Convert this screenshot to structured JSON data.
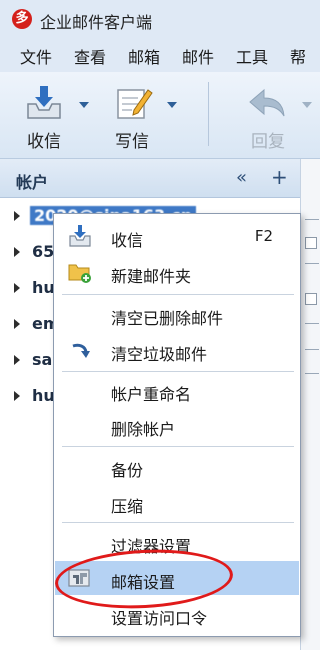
{
  "app": {
    "title": "企业邮件客户端",
    "logo_glyph": "多"
  },
  "menu": [
    "文件",
    "查看",
    "邮箱",
    "邮件",
    "工具",
    "帮助"
  ],
  "toolbar": {
    "receive_label": "收信",
    "compose_label": "写信",
    "reply_label": "回复"
  },
  "panel": {
    "title": "帐户",
    "collapse_glyph": "«",
    "add_glyph": "+"
  },
  "accounts": [
    {
      "name": "2020@sina163.cn"
    },
    {
      "name": "65"
    },
    {
      "name": "hu"
    },
    {
      "name": "em"
    },
    {
      "name": "sa"
    },
    {
      "name": "hu"
    }
  ],
  "context_menu": {
    "receive": {
      "label": "收信",
      "shortcut": "F2"
    },
    "new_folder": {
      "label": "新建邮件夹"
    },
    "empty_deleted": {
      "label": "清空已删除邮件"
    },
    "empty_junk": {
      "label": "清空垃圾邮件"
    },
    "rename_account": {
      "label": "帐户重命名"
    },
    "delete_account": {
      "label": "删除帐户"
    },
    "backup": {
      "label": "备份"
    },
    "compress": {
      "label": "压缩"
    },
    "filter_settings": {
      "label": "过滤器设置"
    },
    "mailbox_settings": {
      "label": "邮箱设置"
    },
    "access_password": {
      "label": "设置访问口令"
    }
  },
  "colors": {
    "highlight": "#b5d2f3",
    "annotation": "#e01a1a",
    "selection": "#3f79c6"
  }
}
